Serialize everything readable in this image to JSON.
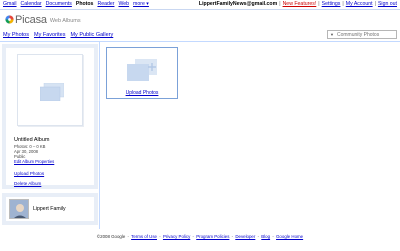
{
  "gbar": {
    "links": [
      "Gmail",
      "Calendar",
      "Documents",
      "Photos",
      "Reader",
      "Web",
      "more ▾"
    ],
    "current": "Photos",
    "email": "LippertFamilyNews@gmail.com",
    "new_features": "New Features!",
    "settings": "Settings",
    "my_account": "My Account",
    "sign_out": "Sign out",
    "sep": "|"
  },
  "logo": {
    "brand": "Picasa",
    "tm": "™",
    "sub": "Web Albums"
  },
  "nav": {
    "my_photos": "My Photos",
    "my_favorites": "My Favorites",
    "my_public_gallery": "My Public Gallery"
  },
  "search": {
    "placeholder": "Community Photos"
  },
  "album": {
    "title": "Untitled Album",
    "photos": "Photos: 0 – 0 KB",
    "date": "Apr 30, 2008",
    "visibility": "Public",
    "edit_properties": "Edit Album Properties",
    "upload_photos": "Upload Photos",
    "delete_album": "Delete Album"
  },
  "user": {
    "name": "Lippert Family"
  },
  "main": {
    "upload_label": "Upload Photos"
  },
  "footer": {
    "copyright": "©2008 Google",
    "links": [
      "Terms of Use",
      "Privacy Policy",
      "Program Policies",
      "Developer",
      "Blog",
      "Google Home"
    ],
    "sep": "-"
  },
  "colors": {
    "link": "#0000cc",
    "panel_bg": "#e8eef7",
    "accent_border": "#7ba1d8",
    "new_features": "#cc0000"
  }
}
